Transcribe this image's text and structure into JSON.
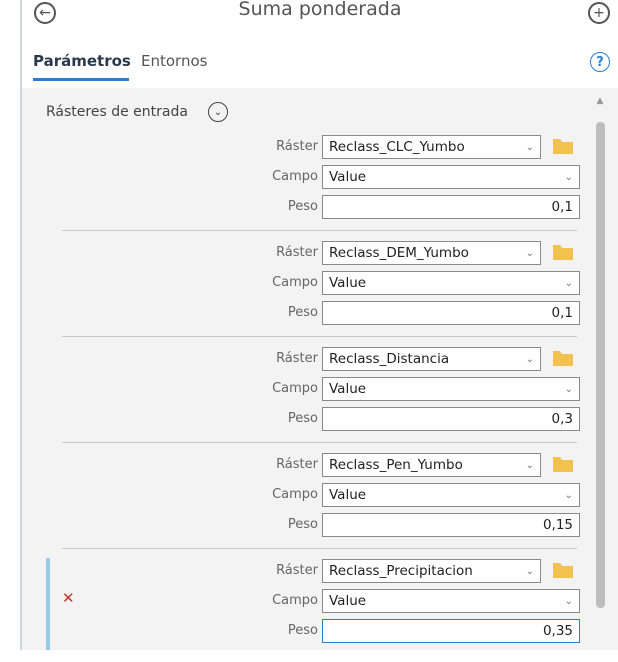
{
  "header": {
    "title": "Suma ponderada"
  },
  "tabs": [
    {
      "label": "Parámetros"
    },
    {
      "label": "Entornos"
    }
  ],
  "section": {
    "label": "Rásteres de entrada"
  },
  "labels": {
    "raster": "Ráster",
    "campo": "Campo",
    "peso": "Peso"
  },
  "rows": [
    {
      "raster": "Reclass_CLC_Yumbo",
      "campo": "Value",
      "peso": "0,1"
    },
    {
      "raster": "Reclass_DEM_Yumbo",
      "campo": "Value",
      "peso": "0,1"
    },
    {
      "raster": "Reclass_Distancia",
      "campo": "Value",
      "peso": "0,3"
    },
    {
      "raster": "Reclass_Pen_Yumbo",
      "campo": "Value",
      "peso": "0,15"
    },
    {
      "raster": "Reclass_Precipitacion",
      "campo": "Value",
      "peso": "0,35"
    }
  ],
  "colors": {
    "accent": "#2b7fd0",
    "folder": "#f2c14e",
    "error": "#c0392b",
    "selected_bar": "#9ccbe8"
  },
  "icons": {
    "back": "arrow-left-circle-icon",
    "add": "plus-circle-icon",
    "help": "help-circle-icon",
    "collapse": "chevron-down-circle-icon",
    "folder": "folder-icon",
    "error": "x-error-icon"
  }
}
